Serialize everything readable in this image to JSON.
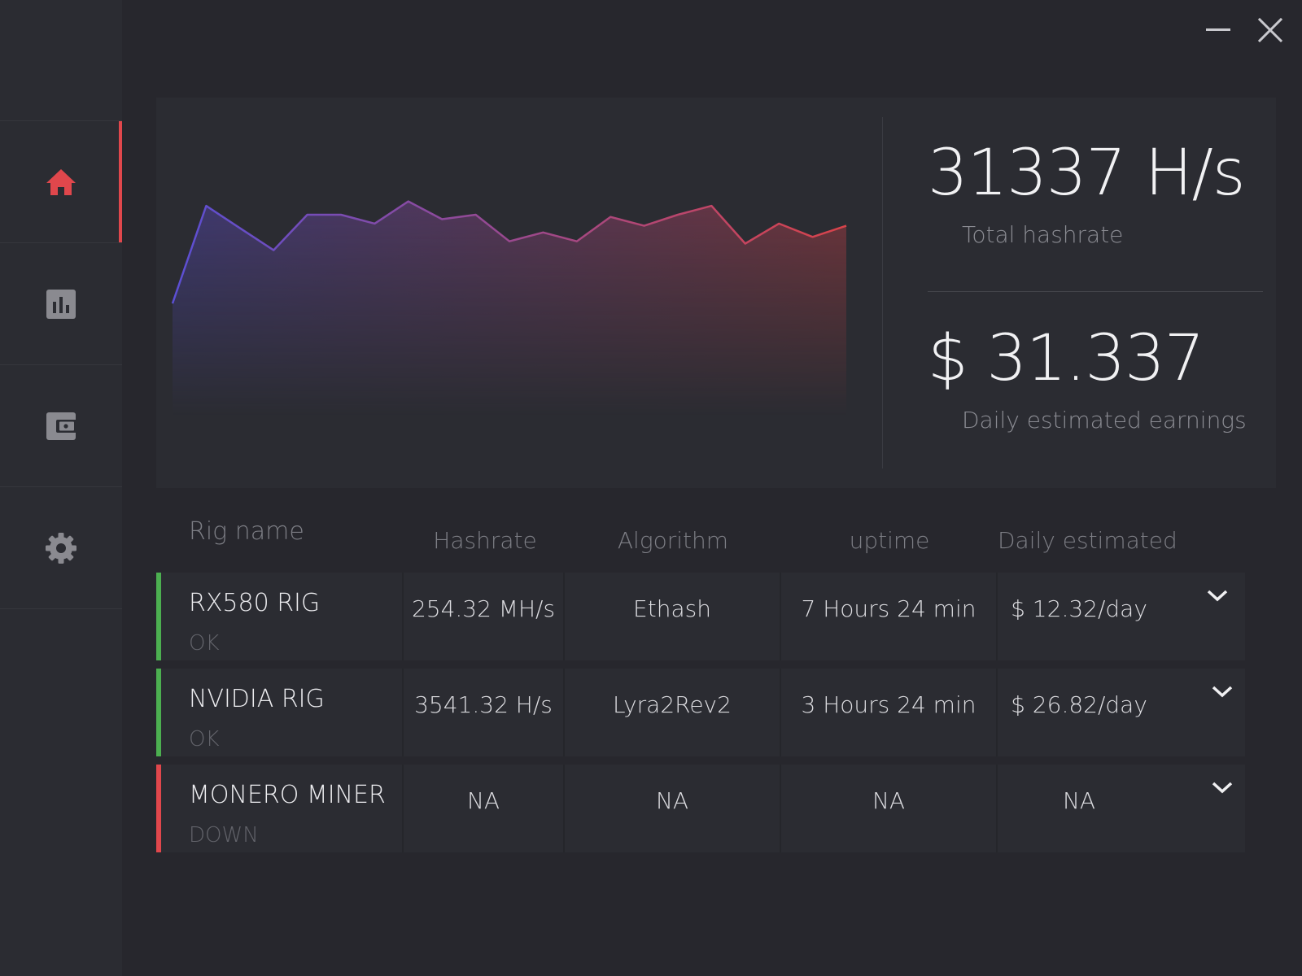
{
  "colors": {
    "accent": "#e0474c",
    "status_ok": "#4caf50",
    "status_down": "#e0474c",
    "chart_start": "#5b4fd4",
    "chart_end": "#d8434a"
  },
  "nav": {
    "items": [
      {
        "id": "home",
        "icon": "home-icon",
        "active": true
      },
      {
        "id": "stats",
        "icon": "bar-chart-icon",
        "active": false
      },
      {
        "id": "wallet",
        "icon": "wallet-icon",
        "active": false
      },
      {
        "id": "settings",
        "icon": "gear-icon",
        "active": false
      }
    ]
  },
  "window": {
    "minimize_icon": "minimize-icon",
    "close_icon": "close-icon"
  },
  "summary": {
    "hashrate_value": "31337 H/s",
    "hashrate_label": "Total hashrate",
    "earnings_value": "$ 31.337",
    "earnings_label": "Daily estimated earnings"
  },
  "chart_data": {
    "type": "area",
    "values": [
      48,
      92,
      82,
      72,
      88,
      88,
      84,
      94,
      86,
      88,
      76,
      80,
      76,
      87,
      83,
      88,
      92,
      75,
      84,
      78,
      83
    ],
    "ylim": [
      0,
      110
    ],
    "grid": false
  },
  "table": {
    "headers": {
      "rig_name": "Rig name",
      "hashrate": "Hashrate",
      "algorithm": "Algorithm",
      "uptime": "uptime",
      "daily": "Daily estimated"
    },
    "rows": [
      {
        "name": "RX580 RIG",
        "status": "OK",
        "status_color": "#4caf50",
        "hashrate": "254.32 MH/s",
        "algorithm": "Ethash",
        "uptime": "7 Hours 24 min",
        "daily": "$ 12.32/day"
      },
      {
        "name": "NVIDIA RIG",
        "status": "OK",
        "status_color": "#4caf50",
        "hashrate": "3541.32 H/s",
        "algorithm": "Lyra2Rev2",
        "uptime": "3 Hours 24 min",
        "daily": "$ 26.82/day"
      },
      {
        "name": "MONERO MINER",
        "status": "DOWN",
        "status_color": "#e0474c",
        "hashrate": "NA",
        "algorithm": "NA",
        "uptime": "NA",
        "daily": "NA"
      }
    ]
  }
}
